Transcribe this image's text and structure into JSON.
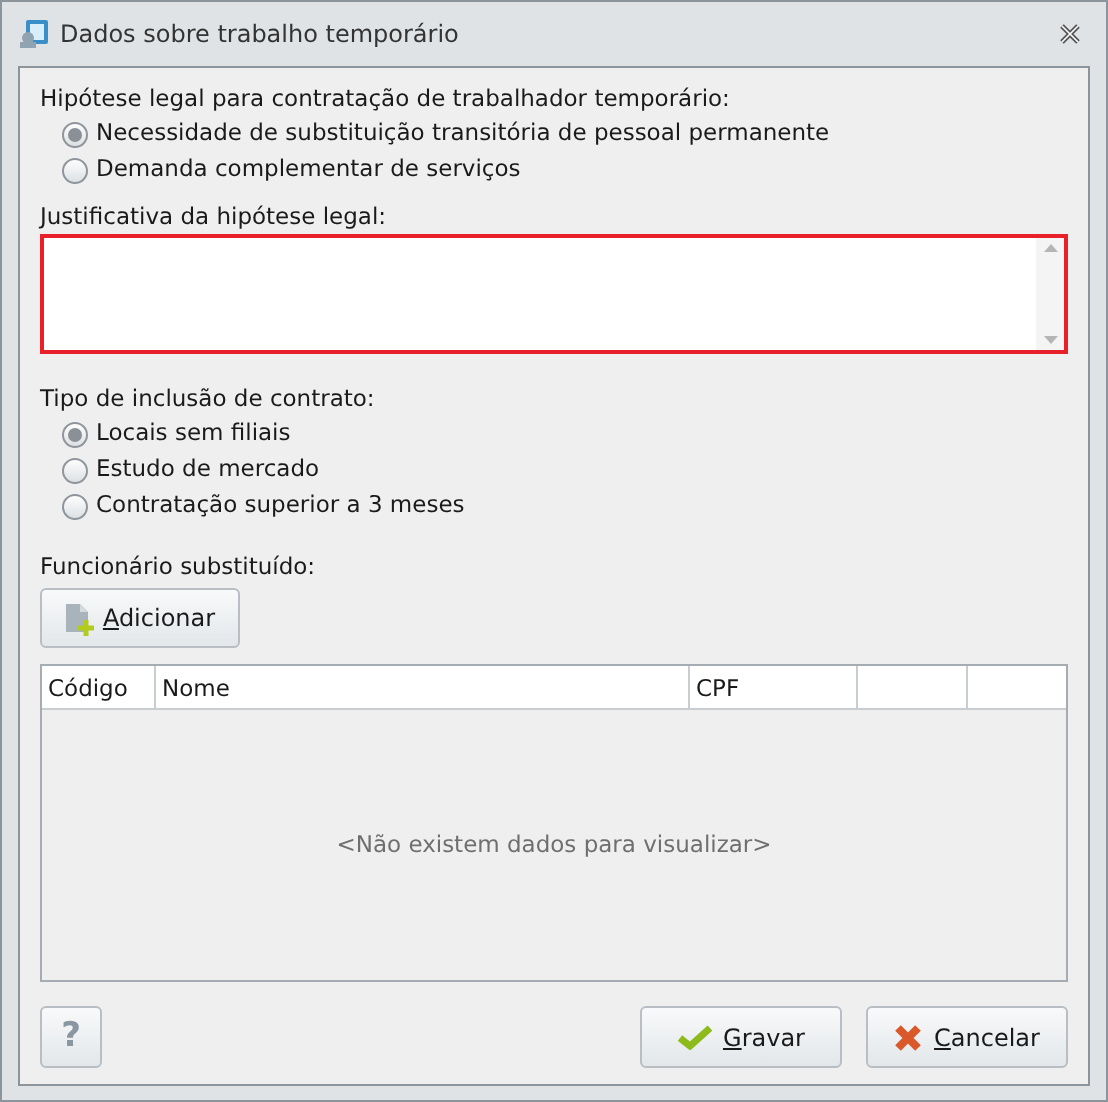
{
  "window": {
    "title": "Dados sobre trabalho temporário"
  },
  "legal_basis": {
    "label": "Hipótese legal para contratação de trabalhador temporário:",
    "options": [
      {
        "label": "Necessidade de substituição transitória de pessoal permanente",
        "selected": true
      },
      {
        "label": "Demanda complementar de serviços",
        "selected": false
      }
    ]
  },
  "justification": {
    "label": "Justificativa da hipótese legal:",
    "invalid": true
  },
  "inclusion_type": {
    "label": "Tipo de inclusão de contrato:",
    "options": [
      {
        "label": "Locais sem filiais",
        "selected": true
      },
      {
        "label": "Estudo de mercado",
        "selected": false
      },
      {
        "label": "Contratação superior a 3 meses",
        "selected": false
      }
    ]
  },
  "replaced_employee": {
    "label": "Funcionário substituído:",
    "add_button": "Adicionar",
    "table": {
      "columns": [
        "Código",
        "Nome",
        "CPF"
      ],
      "empty_message": "<Não existem dados para visualizar>"
    }
  },
  "buttons": {
    "help": "?",
    "save": "Gravar",
    "cancel": "Cancelar"
  }
}
